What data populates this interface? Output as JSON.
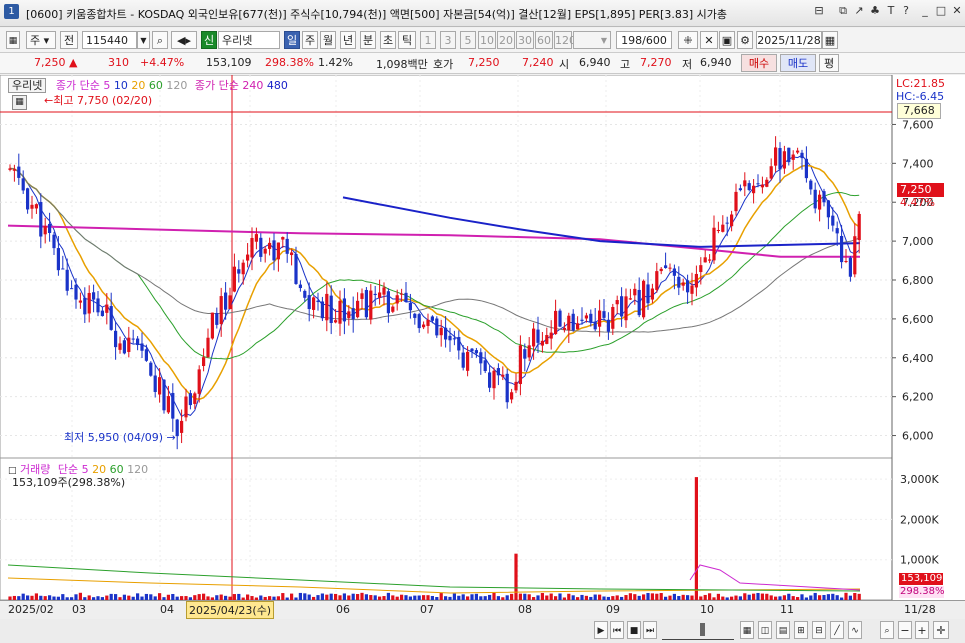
{
  "window": {
    "app_number": "1",
    "title": "[0600] 키움종합차트 - KOSDAQ 외국인보유[677(천)] 주식수[10,794(천)] 액면[500] 자본금[54(억)] 결산[12월] EPS[1,895] PER[3.83] 시가총"
  },
  "toolbar": {
    "period_type": "주",
    "prev_label": "전",
    "stock_code": "115440",
    "market_badge": "신",
    "stock_name": "우리넷",
    "period_buttons": [
      "일",
      "주",
      "월",
      "년",
      "분",
      "초",
      "틱"
    ],
    "interval_buttons": [
      "1",
      "3",
      "5",
      "10",
      "20",
      "30",
      "60",
      "120"
    ],
    "count": "198",
    "count_total": "/600",
    "date": "2025/11/28"
  },
  "quote": {
    "price": "7,250 ▲",
    "change": "310",
    "change_pct": "+4.47%",
    "volume": "153,109",
    "volume_pct": "298.38%",
    "turnover": "1.42%",
    "amount": "1,098백만",
    "hoga_label": "호가",
    "ask": "7,250",
    "bid": "7,240",
    "open_label": "시",
    "open": "6,940",
    "high_label": "고",
    "high": "7,270",
    "low_label": "저",
    "low": "6,940",
    "buy_label": "매수",
    "sell_label": "매도",
    "eval_label": "평"
  },
  "price_legend": {
    "stock_name": "우리넷",
    "ma_label": "종가 단순",
    "ma_periods": [
      "5",
      "10",
      "20",
      "60",
      "120"
    ],
    "ma2_label": "종가 단순",
    "ma2_periods": [
      "240",
      "480"
    ]
  },
  "annotations": {
    "high_marker": "최고 7,750 (02/20)",
    "low_marker": "최저 5,950 (04/09)",
    "lc": "LC:21.85",
    "hc": "HC:-6.45",
    "top_price_box": "7,668",
    "current_price_box": "7,250",
    "current_change_box": "4.47%",
    "crosshair_date": "2025/04/23(수)",
    "volume_price_box": "153,109",
    "volume_pct_box": "298.38%"
  },
  "volume_legend": {
    "label": "거래량",
    "ma_label": "단순",
    "ma_periods": [
      "5",
      "20",
      "60",
      "120"
    ],
    "value": "153,109주(298.38%)"
  },
  "price_axis_ticks": [
    "7,600",
    "7,400",
    "7,200",
    "7,000",
    "6,800",
    "6,600",
    "6,400",
    "6,200",
    "6,000"
  ],
  "volume_axis_ticks": [
    "3,000K",
    "2,000K",
    "1,000K"
  ],
  "x_axis_ticks": [
    "2025/02",
    "03",
    "04",
    "05",
    "06",
    "07",
    "08",
    "09",
    "10",
    "11",
    "11/28"
  ],
  "colors": {
    "up": "#e0101a",
    "down": "#1a33c8",
    "ma5": "#cc2ad0",
    "ma10": "#1a33c8",
    "ma20": "#e8a000",
    "ma60": "#2ca02c",
    "ma120": "#777777",
    "ma240": "#d020b0",
    "ma480": "#1a22c8"
  },
  "chart_data": {
    "type": "candlestick",
    "x_range": [
      "2025/02",
      "2025/11/28"
    ],
    "y_range": [
      5900,
      7700
    ],
    "open": 6940,
    "high": 7270,
    "low": 6940,
    "close": 7250,
    "volume": 153109,
    "period_high": {
      "value": 7750,
      "date": "02/20"
    },
    "period_low": {
      "value": 5950,
      "date": "04/09"
    },
    "moving_averages": [
      "5",
      "10",
      "20",
      "60",
      "120",
      "240",
      "480"
    ]
  }
}
